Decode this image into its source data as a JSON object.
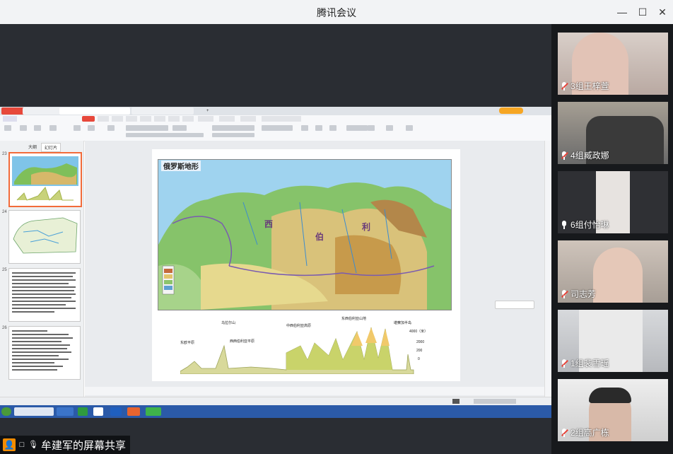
{
  "window": {
    "title": "腾讯会议",
    "minimize": "—",
    "maximize": "☐",
    "close": "✕"
  },
  "share": {
    "label": "牟建军的屏幕共享"
  },
  "participants": [
    {
      "name": "3组王梓萱",
      "mic": "muted"
    },
    {
      "name": "4组臧政娜",
      "mic": "muted"
    },
    {
      "name": "6组付怡琳",
      "mic": "on"
    },
    {
      "name": "司志芳",
      "mic": "muted"
    },
    {
      "name": "1组裴雪瑶",
      "mic": "muted"
    },
    {
      "name": "2组高广栋",
      "mic": "muted"
    }
  ],
  "slide": {
    "map_title": "俄罗斯地形",
    "regions": [
      "西",
      "伯",
      "利"
    ],
    "profile_labels": [
      "乌拉尔山",
      "东西伯利亚山地",
      "中西伯利亚高原",
      "东欧平原",
      "西西伯利亚平原",
      "堪察加半岛"
    ],
    "profile_scale": [
      "4000（米）",
      "2000",
      "200",
      "0"
    ]
  },
  "thumbs": [
    {
      "num": "23"
    },
    {
      "num": "24"
    },
    {
      "num": "25"
    },
    {
      "num": "26"
    }
  ],
  "leftpanel": {
    "tab1": "大纲",
    "tab2": "幻灯片"
  }
}
